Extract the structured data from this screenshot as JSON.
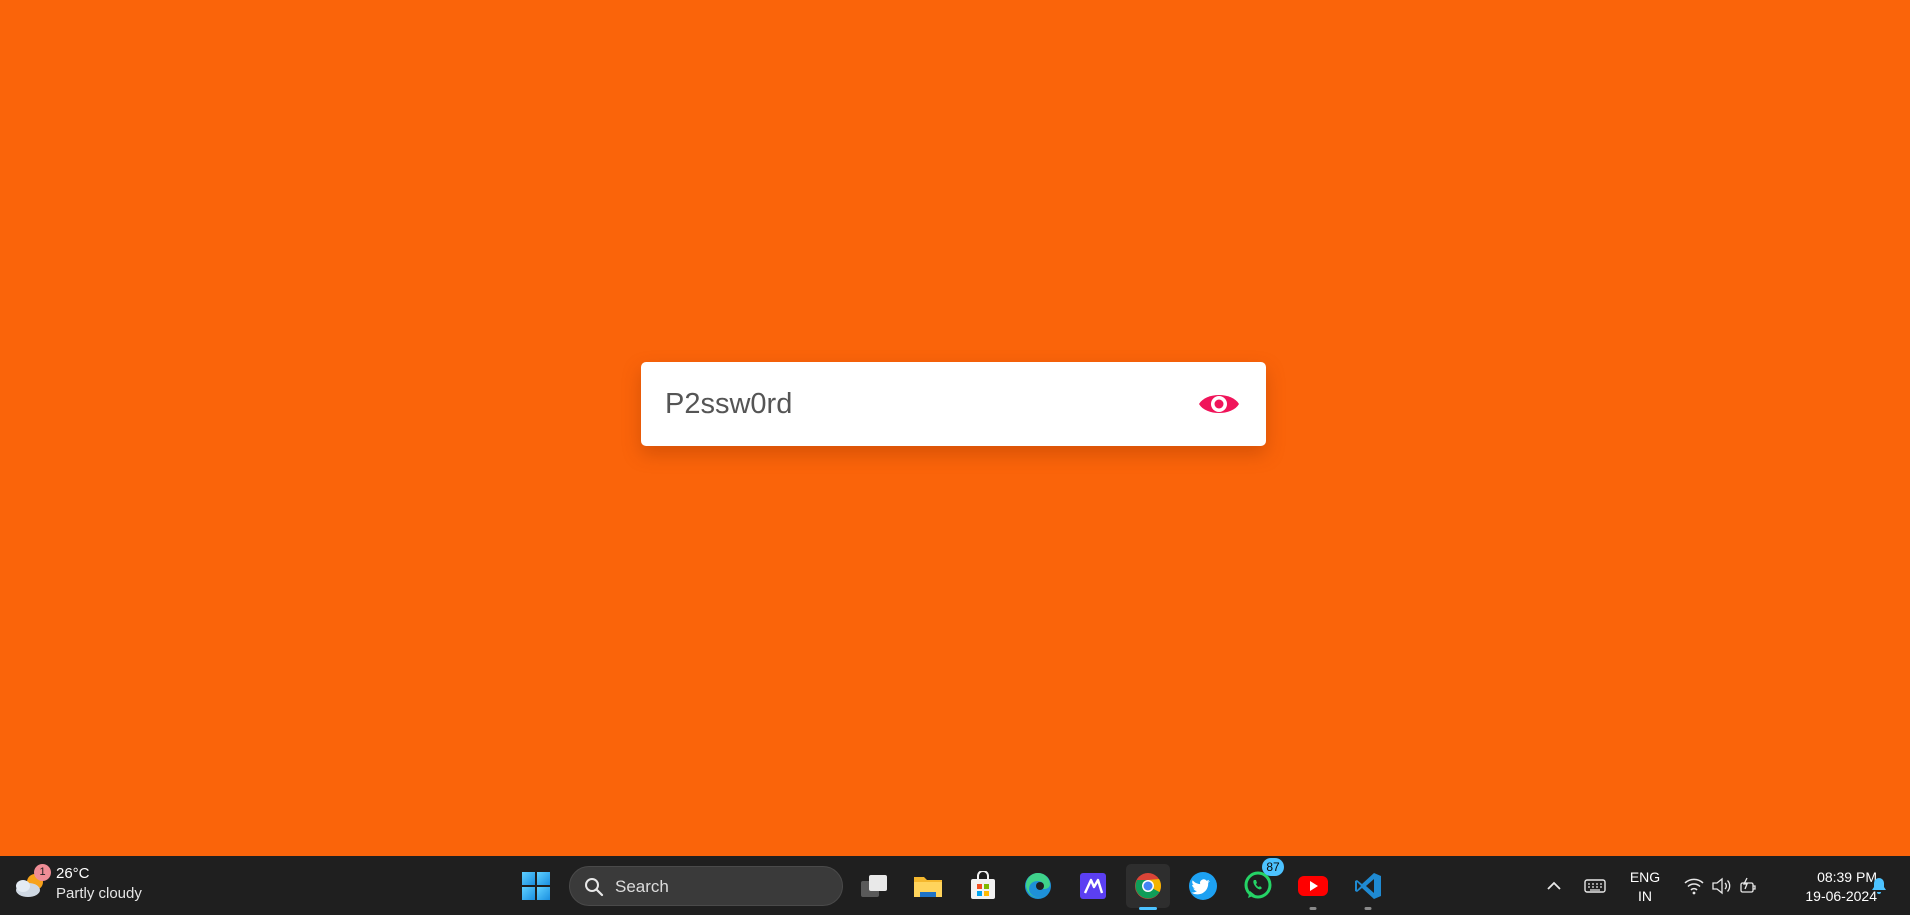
{
  "password_field": {
    "value": "P2ssw0rd",
    "toggle_icon": "eye-icon"
  },
  "colors": {
    "background": "#fa640a",
    "eye_accent": "#f0145a",
    "taskbar": "#1f1f1f"
  },
  "taskbar": {
    "weather": {
      "badge": "1",
      "temperature": "26°C",
      "condition": "Partly cloudy"
    },
    "search_label": "Search",
    "apps": [
      {
        "name": "start",
        "icon": "windows-logo-icon"
      },
      {
        "name": "task-view",
        "icon": "task-view-icon"
      },
      {
        "name": "file-explorer",
        "icon": "folder-icon"
      },
      {
        "name": "microsoft-store",
        "icon": "store-icon"
      },
      {
        "name": "edge",
        "icon": "edge-icon"
      },
      {
        "name": "app",
        "icon": "app-icon"
      },
      {
        "name": "chrome",
        "icon": "chrome-icon",
        "active": true
      },
      {
        "name": "twitter",
        "icon": "twitter-icon"
      },
      {
        "name": "whatsapp",
        "icon": "whatsapp-icon",
        "badge": "87"
      },
      {
        "name": "youtube",
        "icon": "youtube-icon"
      },
      {
        "name": "vscode",
        "icon": "vscode-icon"
      }
    ],
    "tray": {
      "language_line1": "ENG",
      "language_line2": "IN",
      "time": "08:39 PM",
      "date": "19-06-2024"
    }
  }
}
